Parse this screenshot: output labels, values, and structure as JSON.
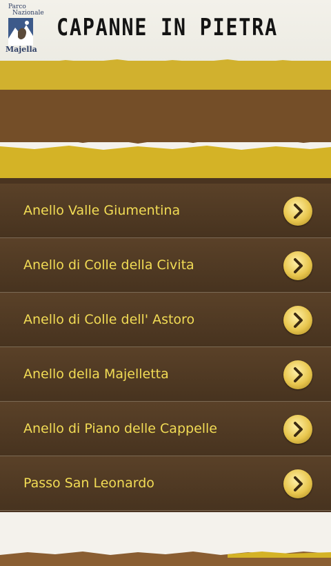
{
  "header": {
    "logo_line1": "Parco",
    "logo_line2": "Nazionale",
    "logo_line3": "Majella",
    "title": "CAPANNE IN PIETRA"
  },
  "icons": {
    "logo": "park-logo-icon",
    "chevron": "chevron-right-icon"
  },
  "colors": {
    "accent_yellow": "#d4b326",
    "brown": "#744e28",
    "row_bg": "#4a3521",
    "label_text": "#f2dc55",
    "title_text": "#141414"
  },
  "routes": [
    {
      "label": "Anello Valle Giumentina"
    },
    {
      "label": "Anello di Colle della Civita"
    },
    {
      "label": "Anello di Colle dell' Astoro"
    },
    {
      "label": "Anello della Majelletta"
    },
    {
      "label": "Anello di Piano delle Cappelle"
    },
    {
      "label": "Passo San Leonardo"
    }
  ]
}
